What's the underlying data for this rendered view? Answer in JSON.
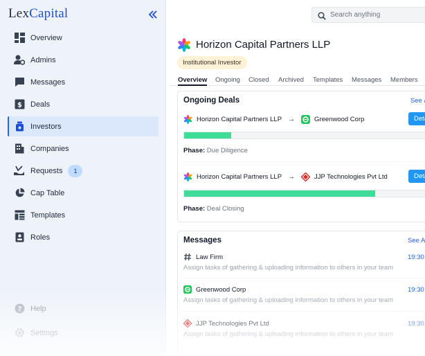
{
  "app": {
    "logo_prefix": "Lex",
    "logo_suffix": "Capital"
  },
  "sidebar": {
    "items": [
      {
        "label": "Overview",
        "icon": "dashboard-icon"
      },
      {
        "label": "Admins",
        "icon": "admin-gear-icon"
      },
      {
        "label": "Messages",
        "icon": "chat-icon"
      },
      {
        "label": "Deals",
        "icon": "dollar-icon"
      },
      {
        "label": "Investors",
        "icon": "money-bag-icon",
        "active": true
      },
      {
        "label": "Companies",
        "icon": "building-icon"
      },
      {
        "label": "Requests",
        "icon": "hand-request-icon",
        "badge": "1"
      },
      {
        "label": "Cap Table",
        "icon": "pie-chart-icon"
      },
      {
        "label": "Templates",
        "icon": "template-icon"
      },
      {
        "label": "Roles",
        "icon": "id-badge-icon"
      }
    ],
    "bottom": [
      {
        "label": "Help",
        "icon": "help-icon"
      },
      {
        "label": "Settings",
        "icon": "settings-icon"
      }
    ]
  },
  "search": {
    "placeholder": "Search anything"
  },
  "org": {
    "name": "Horizon Capital Partners LLP",
    "type": "Institutional Investor"
  },
  "tabs": [
    "Overview",
    "Ongoing",
    "Closed",
    "Archived",
    "Templates",
    "Messages",
    "Members"
  ],
  "deals_card": {
    "title": "Ongoing Deals",
    "see_all": "See all",
    "deals": [
      {
        "from": "Horizon Capital Partners LLP",
        "to": "Greenwood Corp",
        "to_icon": "greenwood-logo-icon",
        "button": "Details",
        "progress": 0.19,
        "phase_label": "Phase:",
        "phase": "Due Diligence"
      },
      {
        "from": "Horizon Capital Partners LLP",
        "to": "JJP Technologies Pvt Ltd",
        "to_icon": "jjp-logo-icon",
        "button": "Details",
        "progress": 0.77,
        "phase_label": "Phase:",
        "phase": "Deal Closing"
      }
    ]
  },
  "messages_card": {
    "title": "Messages",
    "see_all": "See All",
    "items": [
      {
        "from": "Law Firm",
        "icon": "hash-icon",
        "body": "Assign tasks of gathering & uploading information to others in your team",
        "time": "19:30"
      },
      {
        "from": "Greenwood Corp",
        "icon": "greenwood-logo-icon",
        "body": "Assign tasks of gathering & uploading information to others in your team",
        "time": "19:30"
      },
      {
        "from": "JJP Technologies Pvt Ltd",
        "icon": "jjp-logo-icon",
        "body": "Assign tasks of gathering & uploading information to others in your team",
        "time": "19:30"
      }
    ]
  },
  "colors": {
    "accent": "#2563eb",
    "button": "#2196f3",
    "progress": "#3ddc97",
    "sidebar_bg": "#eef3fa",
    "badge_bg": "#fdf1d7"
  }
}
